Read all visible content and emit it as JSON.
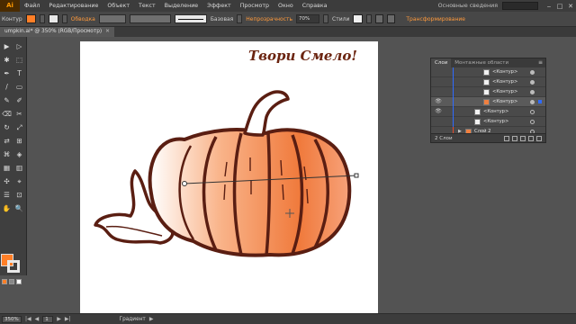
{
  "app": {
    "logo": "Ai"
  },
  "menubar": {
    "items": [
      "Файл",
      "Редактирование",
      "Объект",
      "Текст",
      "Выделение",
      "Эффект",
      "Просмотр",
      "Окно",
      "Справка"
    ],
    "workspace": "Основные сведения",
    "window_controls": [
      "‒",
      "□",
      "✕"
    ]
  },
  "controlbar": {
    "mode_label": "Контур",
    "fill_color": "#ff7f27",
    "stroke_label": "Обводка",
    "stroke_profile": "Базовая",
    "opacity_label": "Непрозрачность",
    "opacity_value": "70%",
    "styles_label": "Стили",
    "transform_label": "Трансформирование"
  },
  "document_tab": {
    "title": "umpkin.ai* @ 350% (RGB/Просмотр)",
    "close": "✕"
  },
  "tools": [
    "▶",
    "▷",
    "✱",
    "⬚",
    "✒",
    "T",
    "/",
    "▭",
    "✎",
    "✐",
    "⌫",
    "✂",
    "↻",
    "⤢",
    "⇄",
    "⊞",
    "⌘",
    "◈",
    "▦",
    "▥",
    "✣",
    "⌖",
    "☰",
    "⊡",
    "✋",
    "🔍"
  ],
  "toolbar_colors": {
    "fill": "#ff7f27",
    "stroke": "#e8e8e8"
  },
  "artwork": {
    "title": "Твори Смело!"
  },
  "layers_panel": {
    "tabs": [
      "Слои",
      "Монтажные области"
    ],
    "menu_icon": "≡",
    "rows": [
      {
        "label": "<Контур>",
        "visible": false,
        "selected": false,
        "thumb": "plain"
      },
      {
        "label": "<Контур>",
        "visible": false,
        "selected": false,
        "thumb": "plain"
      },
      {
        "label": "<Контур>",
        "visible": false,
        "selected": false,
        "thumb": "plain"
      },
      {
        "label": "<Контур>",
        "visible": true,
        "selected": true,
        "thumb": "pumpkin"
      },
      {
        "label": "<Контур>",
        "visible": true,
        "selected": false,
        "thumb": "plain"
      },
      {
        "label": "<Контур>",
        "visible": false,
        "selected": false,
        "thumb": "plain"
      },
      {
        "label": "Слой 2",
        "visible": false,
        "selected": false,
        "thumb": "pumpkin"
      }
    ],
    "footer_text": "2 Слои"
  },
  "statusbar": {
    "zoom": "350%",
    "page_number": "1",
    "tool_name": "Градиент"
  },
  "colors": {
    "accent_orange": "#ff7f27",
    "outline_brown": "#5a1e12",
    "title_color": "#6b2410",
    "selection_blue": "#2f6bff"
  }
}
